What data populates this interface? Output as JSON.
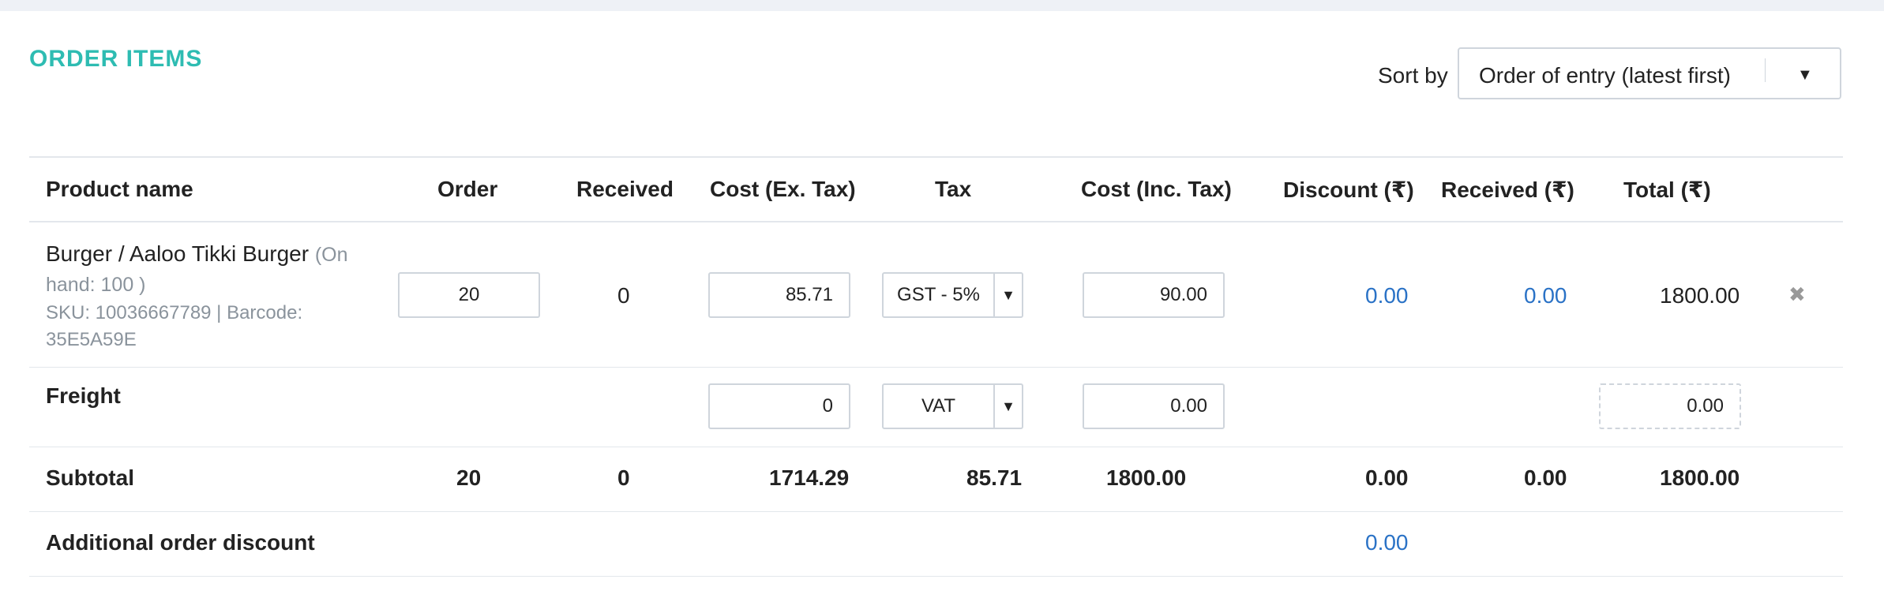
{
  "section": {
    "title": "ORDER ITEMS"
  },
  "sort": {
    "label": "Sort by",
    "value": "Order of entry (latest first)"
  },
  "columns": {
    "product_name": "Product name",
    "order": "Order",
    "received": "Received",
    "cost_ex_tax": "Cost (Ex. Tax)",
    "tax": "Tax",
    "cost_inc_tax": "Cost (Inc. Tax)",
    "discount": "Discount (₹)",
    "received_amount": "Received (₹)",
    "total": "Total (₹)"
  },
  "item": {
    "name": "Burger / Aaloo Tikki Burger",
    "on_hand_line1": "(On",
    "on_hand_line2": "hand: 100 )",
    "sku_line1": "SKU: 10036667789 | Barcode:",
    "sku_line2": "35E5A59E",
    "order_qty": "20",
    "received_qty": "0",
    "cost_ex_tax": "85.71",
    "tax": "GST - 5%",
    "cost_inc_tax": "90.00",
    "discount": "0.00",
    "received_amount": "0.00",
    "total": "1800.00"
  },
  "freight": {
    "label": "Freight",
    "cost": "0",
    "tax": "VAT",
    "cost_inc_tax": "0.00",
    "total": "0.00"
  },
  "subtotal": {
    "label": "Subtotal",
    "order": "20",
    "received": "0",
    "cost_ex_tax": "1714.29",
    "tax": "85.71",
    "cost_inc_tax": "1800.00",
    "discount": "0.00",
    "received_amount": "0.00",
    "total": "1800.00"
  },
  "additional_discount": {
    "label": "Additional order discount",
    "value": "0.00"
  },
  "colors": {
    "accent": "#2ebcb2",
    "link": "#2a72c6",
    "border": "#cfd5dc"
  }
}
